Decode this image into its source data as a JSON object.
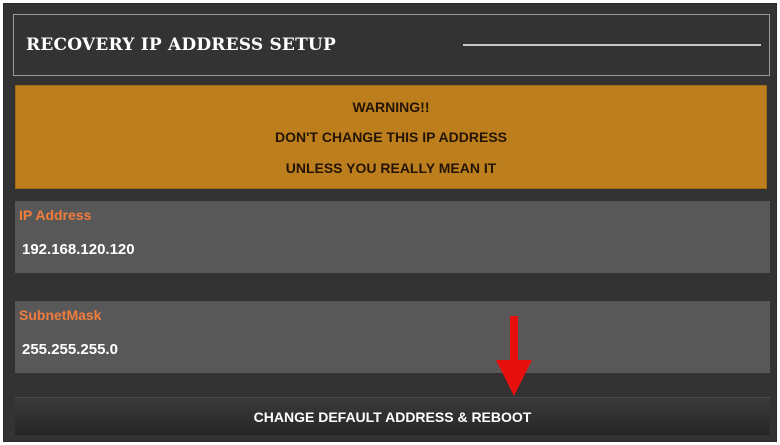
{
  "header": {
    "title": "RECOVERY IP ADDRESS SETUP"
  },
  "warning": {
    "line1": "WARNING!!",
    "line2": "DON'T CHANGE THIS IP ADDRESS",
    "line3": "UNLESS YOU REALLY MEAN IT"
  },
  "ip_field": {
    "label": "IP Address",
    "value": "192.168.120.120"
  },
  "subnet_field": {
    "label": "SubnetMask",
    "value": "255.255.255.0"
  },
  "actions": {
    "reboot_label": "CHANGE DEFAULT ADDRESS & REBOOT"
  },
  "icons": {
    "annotation": "red-arrow-down-icon"
  },
  "colors": {
    "panel_bg": "#333333",
    "warning_bg": "#bd7f1d",
    "field_bg": "#585858",
    "label_accent": "#f27d3c",
    "arrow": "#e8100c"
  }
}
